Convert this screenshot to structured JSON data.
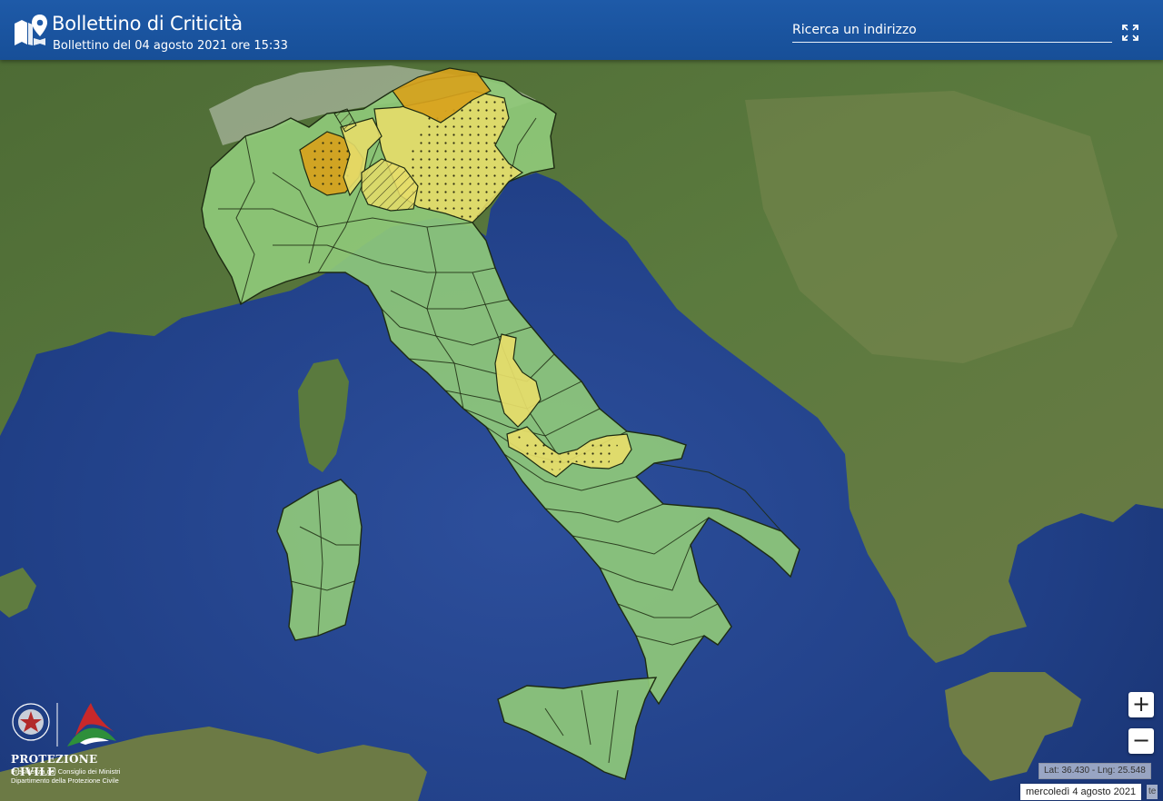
{
  "header": {
    "title": "Bollettino di Criticità",
    "subtitle": "Bollettino del 04 agosto 2021 ore 15:33",
    "search_placeholder": "Ricerca un indirizzo",
    "logo_icon": "map-pin-icon",
    "fullscreen_icon": "fullscreen-icon"
  },
  "zoom": {
    "in_label": "+",
    "out_label": "−"
  },
  "footer_logo": {
    "name": "PROTEZIONE CIVILE",
    "line1": "Presidenza del Consiglio dei Ministri",
    "line2": "Dipartimento della Protezione Civile"
  },
  "coords_label": "Lat: 36.430 - Lng: 25.548",
  "date_label": "mercoledì 4 agosto 2021",
  "attribution_fragment": "te",
  "colors": {
    "header": "#1e5aa8",
    "green_zone": "#8fc97a",
    "yellow_zone": "#e6dd6a",
    "orange_zone": "#d7a21c",
    "sea": "#1f3f87"
  }
}
